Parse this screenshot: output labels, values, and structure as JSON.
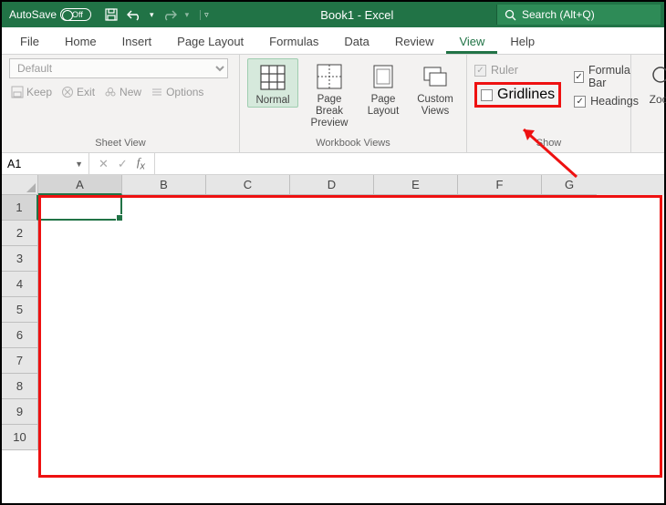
{
  "titlebar": {
    "autosave_label": "AutoSave",
    "toggle_label": "Off",
    "title": "Book1  -  Excel",
    "search_placeholder": "Search (Alt+Q)"
  },
  "tabs": [
    "File",
    "Home",
    "Insert",
    "Page Layout",
    "Formulas",
    "Data",
    "Review",
    "View",
    "Help"
  ],
  "active_tab": "View",
  "ribbon": {
    "sheet_view": {
      "default_label": "Default",
      "keep": "Keep",
      "exit": "Exit",
      "new": "New",
      "options": "Options",
      "group_label": "Sheet View"
    },
    "workbook_views": {
      "normal": "Normal",
      "page_break": "Page Break Preview",
      "page_layout": "Page Layout",
      "custom_views": "Custom Views",
      "group_label": "Workbook Views"
    },
    "show": {
      "ruler": "Ruler",
      "gridlines": "Gridlines",
      "formula_bar": "Formula Bar",
      "headings": "Headings",
      "group_label": "Show"
    },
    "zoom": "Zoom"
  },
  "namebox": "A1",
  "columns": [
    "A",
    "B",
    "C",
    "D",
    "E",
    "F",
    "G"
  ],
  "rows": [
    "1",
    "2",
    "3",
    "4",
    "5",
    "6",
    "7",
    "8",
    "9",
    "10"
  ]
}
